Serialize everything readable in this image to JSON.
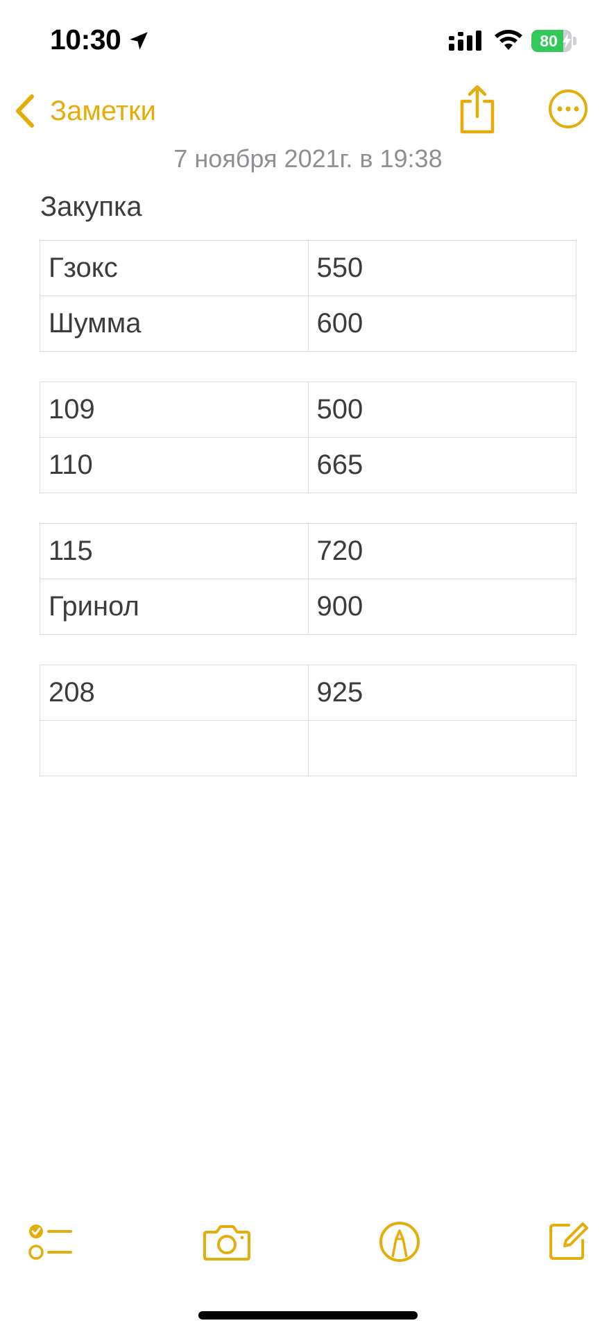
{
  "status_bar": {
    "time": "10:30",
    "battery_percent": "80",
    "battery_level": 0.8,
    "battery_color": "#34c759",
    "icons": [
      "location-arrow-icon",
      "cellular-signal-icon",
      "wifi-icon",
      "battery-charging-icon"
    ]
  },
  "nav": {
    "back_label": "Заметки",
    "accent_color": "#e4ad0a",
    "icons": [
      "chevron-left-icon",
      "share-icon",
      "more-ellipsis-icon"
    ]
  },
  "note": {
    "date": "7 ноября 2021г. в 19:38",
    "title": "Закупка",
    "tables": [
      [
        [
          "Гзокс",
          "550"
        ],
        [
          "Шумма",
          "600"
        ]
      ],
      [
        [
          "109",
          "500"
        ],
        [
          "110",
          "665"
        ]
      ],
      [
        [
          "115",
          "720"
        ],
        [
          "Гринол",
          "900"
        ]
      ],
      [
        [
          "208",
          "925"
        ],
        [
          "",
          ""
        ]
      ]
    ]
  },
  "toolbar": {
    "icons": [
      "checklist-icon",
      "camera-icon",
      "markup-pen-icon",
      "compose-icon"
    ]
  }
}
